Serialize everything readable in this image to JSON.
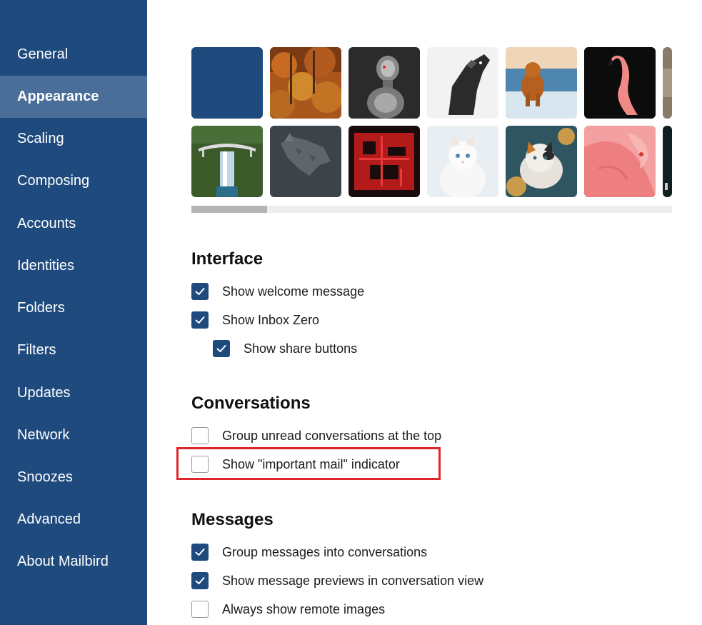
{
  "sidebar": {
    "items": [
      {
        "label": "General",
        "active": false
      },
      {
        "label": "Appearance",
        "active": true
      },
      {
        "label": "Scaling",
        "active": false
      },
      {
        "label": "Composing",
        "active": false
      },
      {
        "label": "Accounts",
        "active": false
      },
      {
        "label": "Identities",
        "active": false
      },
      {
        "label": "Folders",
        "active": false
      },
      {
        "label": "Filters",
        "active": false
      },
      {
        "label": "Updates",
        "active": false
      },
      {
        "label": "Network",
        "active": false
      },
      {
        "label": "Snoozes",
        "active": false
      },
      {
        "label": "Advanced",
        "active": false
      },
      {
        "label": "About Mailbird",
        "active": false
      }
    ]
  },
  "gallery": {
    "row1": [
      "solid-blue",
      "autumn-forest",
      "robot",
      "dog-sketch",
      "dog-beach",
      "flamingo",
      "partial"
    ],
    "row2": [
      "waterfall-bridge",
      "wolf-pattern",
      "circuit-board",
      "white-kitten",
      "calico-kitten",
      "pink-flamingo",
      "partial"
    ],
    "scroll_position": 0.0
  },
  "interface": {
    "title": "Interface",
    "options": [
      {
        "label": "Show welcome message",
        "checked": true
      },
      {
        "label": "Show Inbox Zero",
        "checked": true
      },
      {
        "label": "Show share buttons",
        "checked": true
      }
    ]
  },
  "conversations": {
    "title": "Conversations",
    "options": [
      {
        "label": "Group unread conversations at the top",
        "checked": false
      },
      {
        "label": "Show \"important mail\" indicator",
        "checked": false
      }
    ]
  },
  "messages": {
    "title": "Messages",
    "options": [
      {
        "label": "Group messages into conversations",
        "checked": true
      },
      {
        "label": "Show message previews in conversation view",
        "checked": true
      },
      {
        "label": "Always show remote images",
        "checked": false
      }
    ]
  },
  "colors": {
    "sidebar": "#1f4a7e",
    "sidebar_active": "#4a6e98",
    "checkbox_checked": "#1f4a7e",
    "highlight": "#e0262d"
  }
}
